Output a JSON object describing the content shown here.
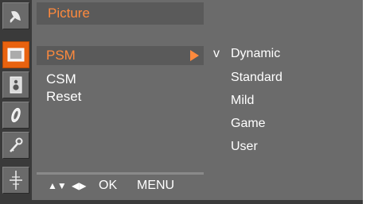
{
  "osd": {
    "title": "Picture",
    "menu": {
      "items": [
        {
          "label": "PSM"
        },
        {
          "label": "CSM"
        },
        {
          "label": "Reset"
        }
      ]
    },
    "options": {
      "items": [
        {
          "label": "Dynamic",
          "check": "v"
        },
        {
          "label": "Standard",
          "check": ""
        },
        {
          "label": "Mild",
          "check": ""
        },
        {
          "label": "Game",
          "check": ""
        },
        {
          "label": "User",
          "check": ""
        }
      ]
    },
    "footer": {
      "updown_glyph": "▲▼",
      "leftright_glyph": "◀▶",
      "ok_label": "OK",
      "menu_label": "MENU"
    }
  },
  "sidebar": {
    "items": [
      {
        "icon": "satellite-dish-icon"
      },
      {
        "icon": "picture-icon"
      },
      {
        "icon": "speaker-icon"
      },
      {
        "icon": "clock-icon"
      },
      {
        "icon": "key-icon"
      },
      {
        "icon": "antenna-icon"
      }
    ]
  },
  "colors": {
    "accent": "#ff8a3d",
    "panel": "#6b6b6b",
    "selected_bg": "#5a5a5a",
    "active_icon_bg": "#e8620f"
  }
}
